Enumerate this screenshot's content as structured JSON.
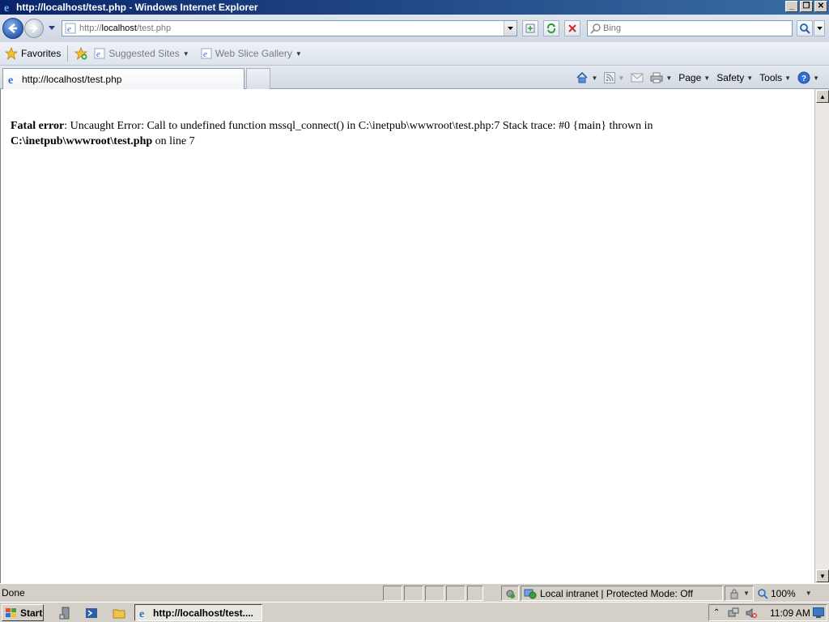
{
  "window": {
    "title": "http://localhost/test.php - Windows Internet Explorer"
  },
  "address_bar": {
    "url_prefix": "http://",
    "url_host": "localhost",
    "url_path": "/test.php"
  },
  "search": {
    "placeholder": "Bing"
  },
  "favorites_bar": {
    "favorites_label": "Favorites",
    "suggested_sites_label": "Suggested Sites",
    "web_slice_gallery_label": "Web Slice Gallery"
  },
  "tab": {
    "active_label": "http://localhost/test.php"
  },
  "command_bar": {
    "page_label": "Page",
    "safety_label": "Safety",
    "tools_label": "Tools"
  },
  "content": {
    "error_label": "Fatal error",
    "error_message": ": Uncaught Error: Call to undefined function mssql_connect() in C:\\inetpub\\wwwroot\\test.php:7 Stack trace: #0 {main} thrown in ",
    "error_file": "C:\\inetpub\\wwwroot\\test.php",
    "error_on_line_text": " on line ",
    "error_line": "7"
  },
  "status_bar": {
    "status": "Done",
    "zone": "Local intranet | Protected Mode: Off",
    "zoom": "100%"
  },
  "taskbar": {
    "start_label": "Start",
    "task_label": "http://localhost/test....",
    "clock": "11:09 AM"
  }
}
